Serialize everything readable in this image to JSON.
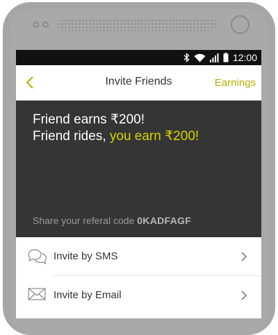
{
  "status_bar": {
    "time": "12:00",
    "icons": [
      "bluetooth-icon",
      "wifi-icon",
      "signal-icon",
      "battery-icon"
    ]
  },
  "header": {
    "back_icon": "chevron-left-icon",
    "title": "Invite Friends",
    "earnings_label": "Earnings"
  },
  "hero": {
    "line1": "Friend earns ₹200!",
    "line2_prefix": "Friend rides, ",
    "line2_highlight": "you earn ₹200!",
    "referral_prefix": "Share your referal code ",
    "referral_code": "0KADFAGF"
  },
  "invite_options": [
    {
      "icon": "chat-bubbles-icon",
      "label": "Invite by SMS"
    },
    {
      "icon": "envelope-icon",
      "label": "Invite by Email"
    }
  ],
  "colors": {
    "accent": "#d8d400",
    "hero_background": "#353535",
    "status_bar": "#111111",
    "phone_frame": "#a6a6a6"
  }
}
